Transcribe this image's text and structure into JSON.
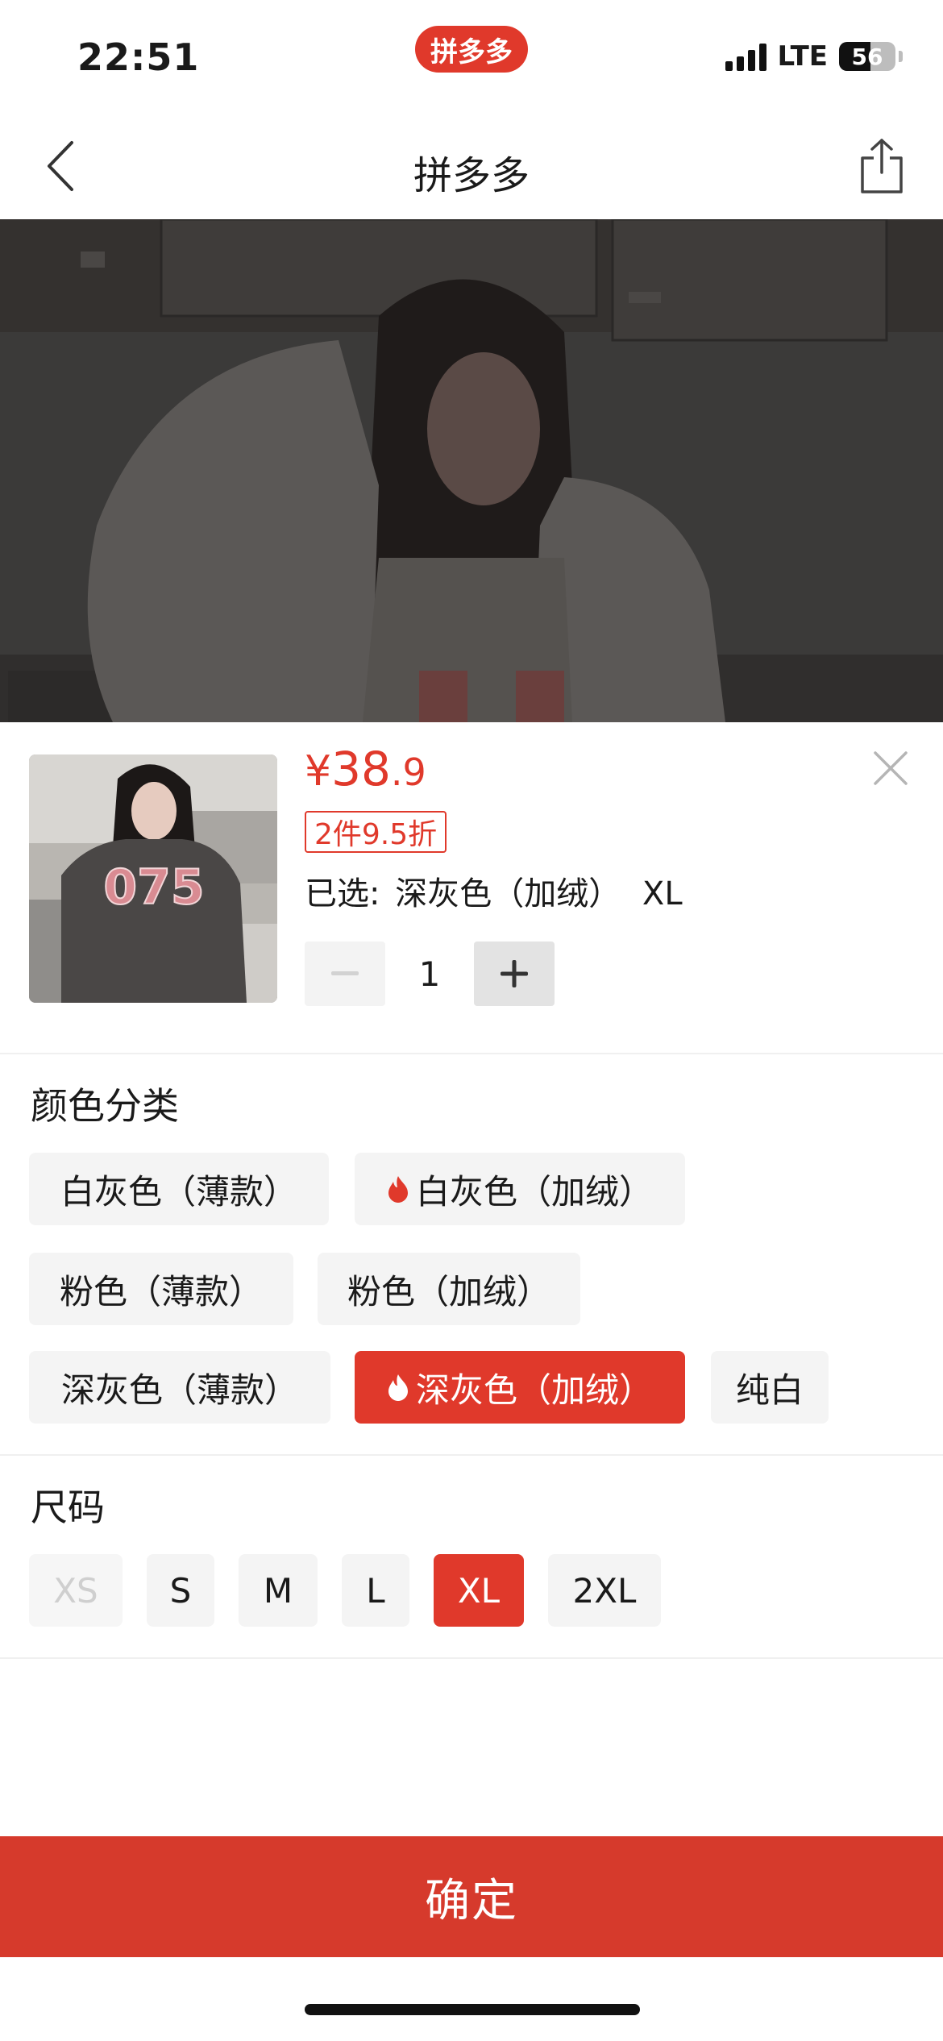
{
  "status_bar": {
    "time": "22:51",
    "app_logo_text": "拼多多",
    "network": "LTE",
    "battery": "56",
    "battery_level_percent": 56
  },
  "nav": {
    "title": "拼多多",
    "back_icon": "chevron-left-icon",
    "share_icon": "share-icon"
  },
  "product": {
    "price_symbol": "¥",
    "price_integer": "38",
    "price_decimal": ".9",
    "discount_badge": "2件9.5折",
    "selected_prefix": "已选:",
    "selected_color": "深灰色（加绒）",
    "selected_size": "XL",
    "quantity": "1",
    "thumbnail_print": "075"
  },
  "colors": {
    "title": "颜色分类",
    "options": [
      {
        "label": "白灰色（薄款）",
        "hot": false,
        "selected": false
      },
      {
        "label": "白灰色（加绒）",
        "hot": true,
        "selected": false
      },
      {
        "label": "粉色（薄款）",
        "hot": false,
        "selected": false
      },
      {
        "label": "粉色（加绒）",
        "hot": false,
        "selected": false
      },
      {
        "label": "深灰色（薄款）",
        "hot": false,
        "selected": false
      },
      {
        "label": "深灰色（加绒）",
        "hot": true,
        "selected": true
      },
      {
        "label": "纯白",
        "hot": false,
        "selected": false
      }
    ]
  },
  "sizes": {
    "title": "尺码",
    "options": [
      {
        "label": "XS",
        "disabled": true,
        "selected": false
      },
      {
        "label": "S",
        "disabled": false,
        "selected": false
      },
      {
        "label": "M",
        "disabled": false,
        "selected": false
      },
      {
        "label": "L",
        "disabled": false,
        "selected": false
      },
      {
        "label": "XL",
        "disabled": false,
        "selected": true
      },
      {
        "label": "2XL",
        "disabled": false,
        "selected": false
      }
    ]
  },
  "confirm_label": "确定",
  "theme": {
    "accent": "#e0392b",
    "confirm_bg": "#d63a2c",
    "chip_bg": "#f4f4f4"
  }
}
